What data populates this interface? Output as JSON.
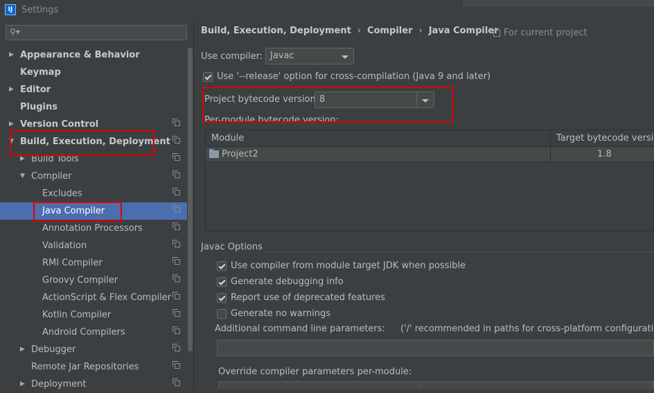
{
  "window": {
    "icon_label": "IJ",
    "title": "Settings"
  },
  "sidebar": {
    "search": {
      "icon": "search-icon",
      "value": ""
    },
    "items": [
      {
        "id": "appearance",
        "label": "Appearance & Behavior",
        "arrow": "▶",
        "bold": true
      },
      {
        "id": "keymap",
        "label": "Keymap",
        "arrow": "",
        "bold": true
      },
      {
        "id": "editor",
        "label": "Editor",
        "arrow": "▶",
        "bold": true
      },
      {
        "id": "plugins",
        "label": "Plugins",
        "arrow": "",
        "bold": true
      },
      {
        "id": "version-control",
        "label": "Version Control",
        "arrow": "▶",
        "bold": true
      },
      {
        "id": "build",
        "label": "Build, Execution, Deployment",
        "arrow": "▼",
        "bold": true
      },
      {
        "id": "build-tools",
        "label": "Build Tools",
        "arrow": "▶",
        "bold": false
      },
      {
        "id": "compiler",
        "label": "Compiler",
        "arrow": "▼",
        "bold": false
      },
      {
        "id": "excludes",
        "label": "Excludes",
        "arrow": "",
        "bold": false
      },
      {
        "id": "java-compiler",
        "label": "Java Compiler",
        "arrow": "",
        "bold": false,
        "selected": true
      },
      {
        "id": "annotation-processors",
        "label": "Annotation Processors",
        "arrow": "",
        "bold": false
      },
      {
        "id": "validation",
        "label": "Validation",
        "arrow": "",
        "bold": false
      },
      {
        "id": "rmi-compiler",
        "label": "RMI Compiler",
        "arrow": "",
        "bold": false
      },
      {
        "id": "groovy-compiler",
        "label": "Groovy Compiler",
        "arrow": "",
        "bold": false
      },
      {
        "id": "actionscript-compiler",
        "label": "ActionScript & Flex Compiler",
        "arrow": "",
        "bold": false
      },
      {
        "id": "kotlin-compiler",
        "label": "Kotlin Compiler",
        "arrow": "",
        "bold": false
      },
      {
        "id": "android-compilers",
        "label": "Android Compilers",
        "arrow": "",
        "bold": false
      },
      {
        "id": "debugger",
        "label": "Debugger",
        "arrow": "▶",
        "bold": false
      },
      {
        "id": "remote-jar",
        "label": "Remote Jar Repositories",
        "arrow": "",
        "bold": false
      },
      {
        "id": "deployment",
        "label": "Deployment",
        "arrow": "▶",
        "bold": false
      }
    ]
  },
  "breadcrumb": {
    "parts": [
      "Build, Execution, Deployment",
      "Compiler",
      "Java Compiler"
    ],
    "separator": "›",
    "for_project": "For current project"
  },
  "main": {
    "use_compiler_label": "Use compiler:",
    "use_compiler_value": "Javac",
    "release_option": {
      "label": "Use '--release' option for cross-compilation (Java 9 and later)",
      "checked": true
    },
    "bytecode_label": "Project bytecode version:",
    "bytecode_value": "8",
    "per_module_label": "Per-module bytecode version:",
    "module_table": {
      "headers": [
        "Module",
        "Target bytecode version"
      ],
      "rows": [
        {
          "module": "Project2",
          "target": "1.8"
        }
      ]
    },
    "javac_section": "Javac Options",
    "options": [
      {
        "label": "Use compiler from module target JDK when possible",
        "checked": true
      },
      {
        "label": "Generate debugging info",
        "checked": true
      },
      {
        "label": "Report use of deprecated features",
        "checked": true
      },
      {
        "label": "Generate no warnings",
        "checked": false
      }
    ],
    "additional_params_label": "Additional command line parameters:",
    "additional_params_hint": "('/' recommended in paths for cross-platform configurations)",
    "additional_params_value": "",
    "override_label": "Override compiler parameters per-module:"
  },
  "colors": {
    "background": "#3c3f41",
    "selection": "#4b6eaf",
    "highlight_box": "#e00000"
  }
}
